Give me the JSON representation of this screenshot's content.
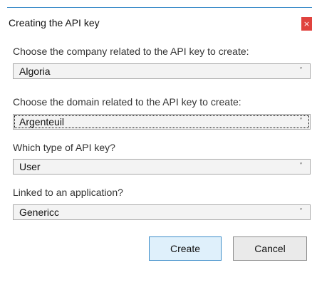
{
  "dialog": {
    "title": "Creating the API key",
    "close_icon": "close-icon",
    "close_glyph": "×"
  },
  "fields": {
    "company": {
      "label": "Choose the company related to the API key to create:",
      "value": "Algoria"
    },
    "domain": {
      "label": "Choose the domain related to the API key to create:",
      "value": "Argenteuil"
    },
    "api_key_type": {
      "label": "Which type of API key?",
      "value": "User"
    },
    "application": {
      "label": "Linked to an application?",
      "value": "Genericc"
    }
  },
  "dropdown_icon": "chevron-down-icon",
  "chevron_glyph": "˅",
  "buttons": {
    "create": "Create",
    "cancel": "Cancel"
  },
  "colors": {
    "accent": "#3c8dc9",
    "close_button": "#e0433e",
    "create_button_bg": "#dff0fb"
  }
}
